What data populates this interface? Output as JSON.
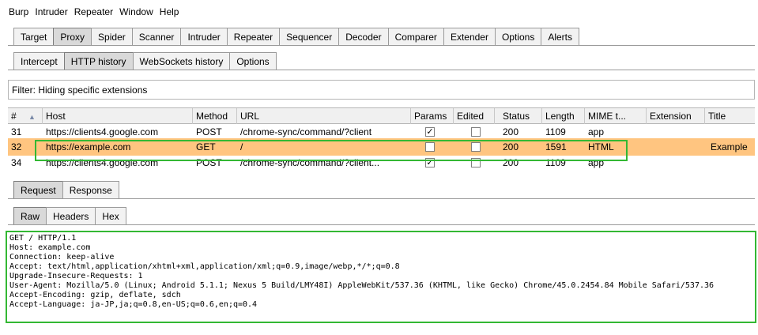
{
  "menu": [
    "Burp",
    "Intruder",
    "Repeater",
    "Window",
    "Help"
  ],
  "top_tabs": [
    {
      "label": "Target",
      "active": false
    },
    {
      "label": "Proxy",
      "active": true
    },
    {
      "label": "Spider",
      "active": false
    },
    {
      "label": "Scanner",
      "active": false
    },
    {
      "label": "Intruder",
      "active": false
    },
    {
      "label": "Repeater",
      "active": false
    },
    {
      "label": "Sequencer",
      "active": false
    },
    {
      "label": "Decoder",
      "active": false
    },
    {
      "label": "Comparer",
      "active": false
    },
    {
      "label": "Extender",
      "active": false
    },
    {
      "label": "Options",
      "active": false
    },
    {
      "label": "Alerts",
      "active": false
    }
  ],
  "proxy_tabs": [
    {
      "label": "Intercept",
      "active": false
    },
    {
      "label": "HTTP history",
      "active": true
    },
    {
      "label": "WebSockets history",
      "active": false
    },
    {
      "label": "Options",
      "active": false
    }
  ],
  "filter": {
    "text": "Filter: Hiding specific extensions"
  },
  "table": {
    "headers": [
      "#",
      "Host",
      "Method",
      "URL",
      "Params",
      "Edited",
      "Status",
      "Length",
      "MIME t...",
      "Extension",
      "Title"
    ],
    "sort_indicator": "▲",
    "rows": [
      {
        "num": "31",
        "host": "https://clients4.google.com",
        "method": "POST",
        "url": "/chrome-sync/command/?client",
        "params": true,
        "edited": false,
        "status": "200",
        "length": "1109",
        "mime": "app",
        "extension": "",
        "title": "",
        "selected": false
      },
      {
        "num": "32",
        "host": "https://example.com",
        "method": "GET",
        "url": "/",
        "params": false,
        "edited": false,
        "status": "200",
        "length": "1591",
        "mime": "HTML",
        "extension": "",
        "title": "Example",
        "selected": true
      },
      {
        "num": "34",
        "host": "https://clients4.google.com",
        "method": "POST",
        "url": "/chrome-sync/command/?client...",
        "params": true,
        "edited": false,
        "status": "200",
        "length": "1109",
        "mime": "app",
        "extension": "",
        "title": "",
        "selected": false
      }
    ]
  },
  "message_tabs": [
    {
      "label": "Request",
      "active": true
    },
    {
      "label": "Response",
      "active": false
    }
  ],
  "view_tabs": [
    {
      "label": "Raw",
      "active": true
    },
    {
      "label": "Headers",
      "active": false
    },
    {
      "label": "Hex",
      "active": false
    }
  ],
  "raw_request": [
    "GET / HTTP/1.1",
    "Host: example.com",
    "Connection: keep-alive",
    "Accept: text/html,application/xhtml+xml,application/xml;q=0.9,image/webp,*/*;q=0.8",
    "Upgrade-Insecure-Requests: 1",
    "User-Agent: Mozilla/5.0 (Linux; Android 5.1.1; Nexus 5 Build/LMY48I) AppleWebKit/537.36 (KHTML, like Gecko) Chrome/45.0.2454.84 Mobile Safari/537.36",
    "Accept-Encoding: gzip, deflate, sdch",
    "Accept-Language: ja-JP,ja;q=0.8,en-US;q=0.6,en;q=0.4"
  ],
  "colors": {
    "selected_row": "#ffc580",
    "highlight_box": "#33b833"
  }
}
